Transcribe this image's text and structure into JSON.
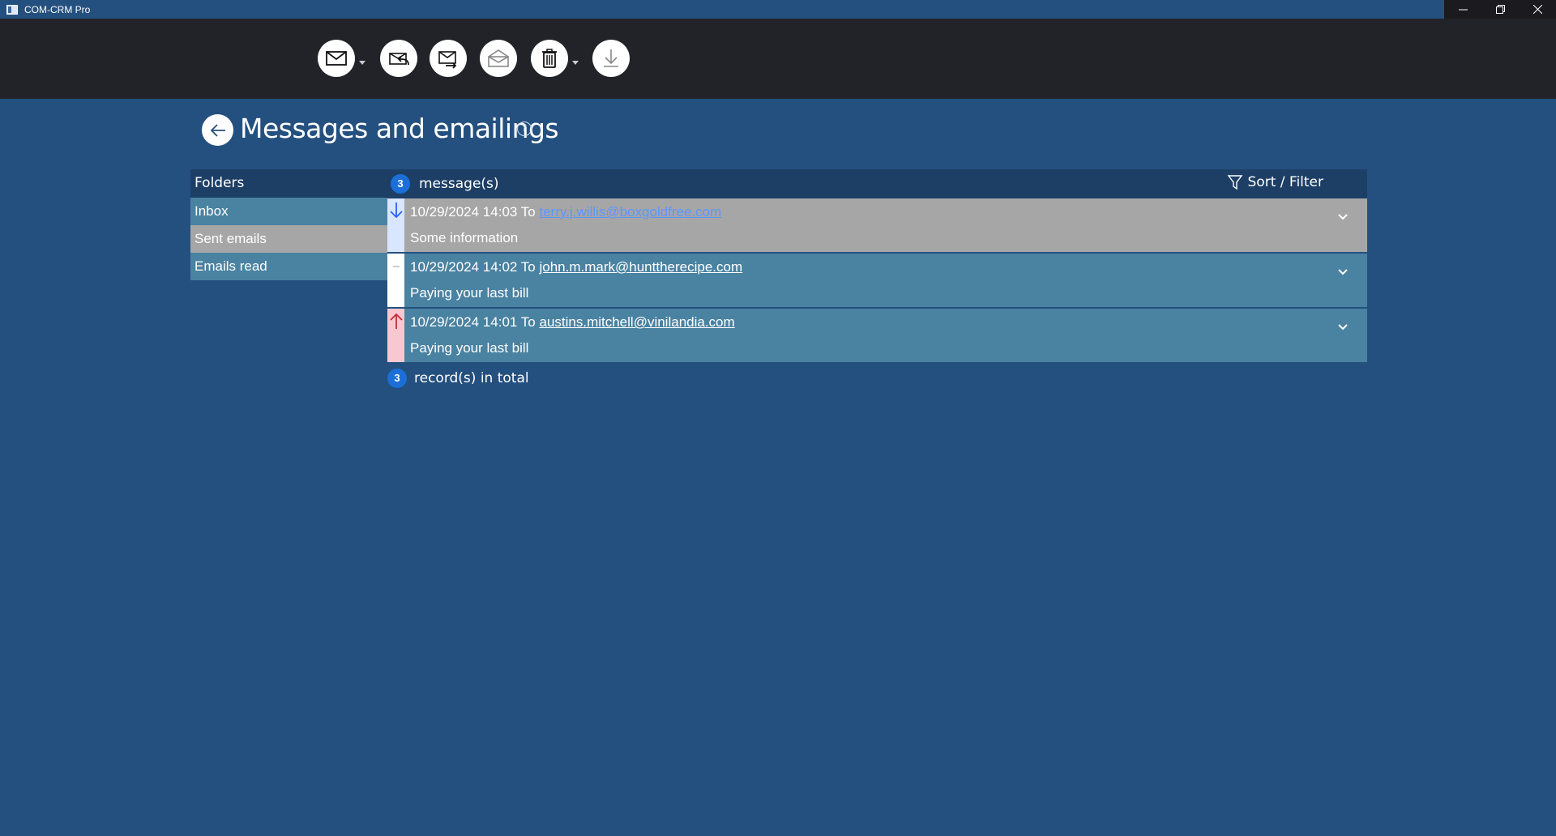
{
  "window": {
    "title": "COM-CRM Pro"
  },
  "toolbar": {
    "buttons": [
      {
        "icon": "envelope-icon",
        "has_dropdown": true
      },
      {
        "icon": "reply-icon",
        "has_dropdown": false
      },
      {
        "icon": "forward-icon",
        "has_dropdown": false
      },
      {
        "icon": "open-envelope-icon",
        "has_dropdown": false
      },
      {
        "icon": "trash-icon",
        "has_dropdown": true
      },
      {
        "icon": "download-icon",
        "has_dropdown": false
      }
    ]
  },
  "page": {
    "title": "Messages and emailings",
    "help_glyph": "?"
  },
  "folders": {
    "header": "Folders",
    "items": [
      {
        "label": "Inbox",
        "color": "#4a82a1"
      },
      {
        "label": "Sent emails",
        "color": "#a6a6a6"
      },
      {
        "label": "Emails read",
        "color": "#4a82a1"
      }
    ]
  },
  "messages": {
    "count": "3",
    "count_label": "message(s)",
    "sort_filter_label": "Sort / Filter",
    "items": [
      {
        "direction": "incoming",
        "datetime": "10/29/2024 14:03",
        "to_label": "To",
        "recipient": "terry.j.willis@boxgoldfree.com",
        "subject": "Some information"
      },
      {
        "direction": "neutral",
        "datetime": "10/29/2024 14:02",
        "to_label": "To",
        "recipient": "john.m.mark@hunttherecipe.com",
        "subject": "Paying your last bill"
      },
      {
        "direction": "outgoing",
        "datetime": "10/29/2024 14:01",
        "to_label": "To",
        "recipient": "austins.mitchell@vinilandia.com",
        "subject": "Paying your last bill"
      }
    ]
  },
  "footer": {
    "records_count": "3",
    "records_label": "record(s) in total"
  },
  "colors": {
    "background": "#24507f",
    "toolbar": "#212328",
    "header_bar": "#1d3f66",
    "row_blue": "#4a82a1",
    "row_gray": "#a6a6a6",
    "badge": "#1c6fd8",
    "incoming_arrow": "#2f5fff",
    "outgoing_arrow": "#c0303a"
  }
}
